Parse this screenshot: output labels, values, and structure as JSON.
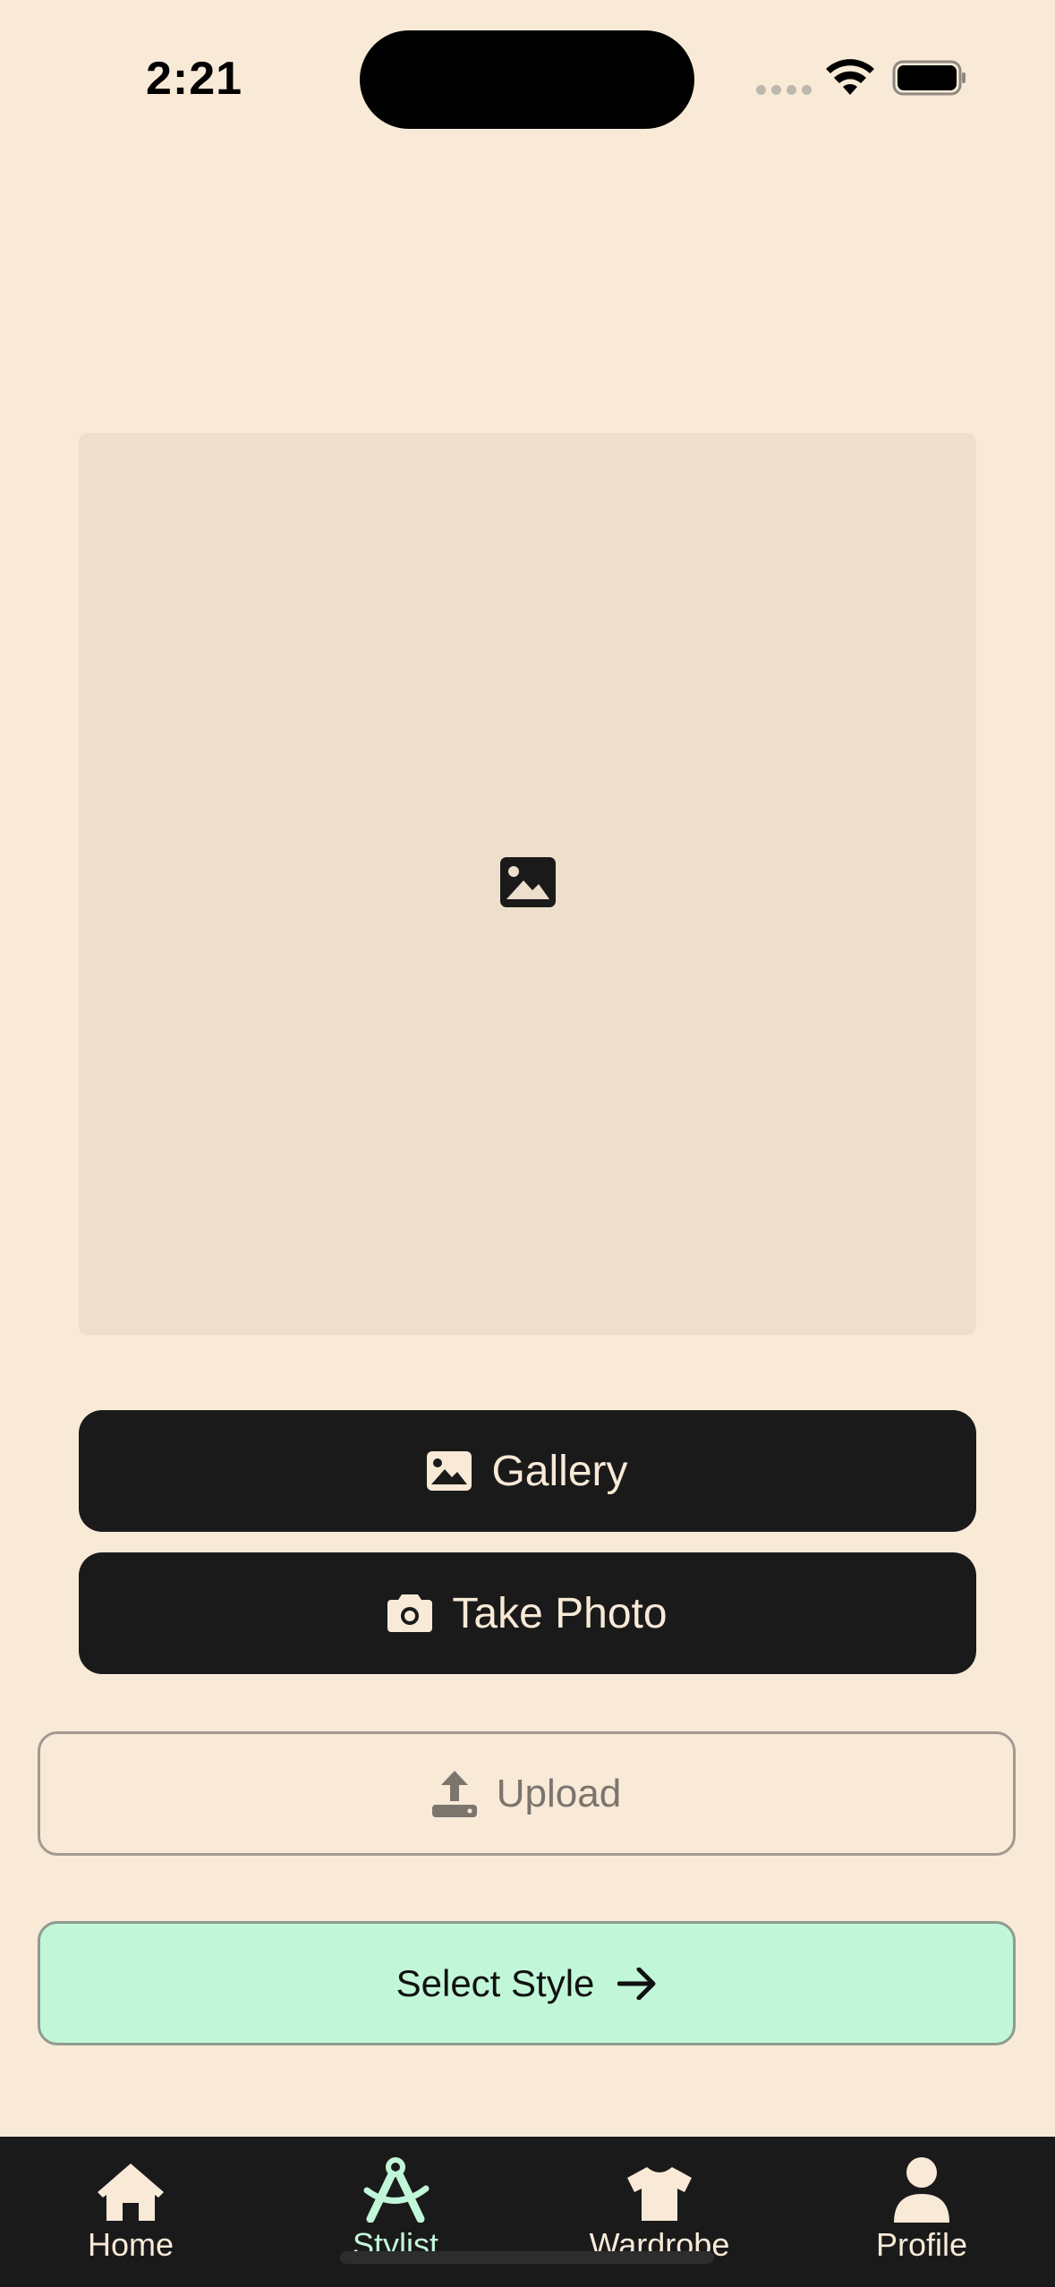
{
  "status_bar": {
    "time": "2:21"
  },
  "buttons": {
    "gallery_label": "Gallery",
    "take_photo_label": "Take Photo",
    "upload_label": "Upload",
    "select_style_label": "Select Style"
  },
  "tab_bar": {
    "items": [
      {
        "label": "Home",
        "icon": "home-icon",
        "active": false
      },
      {
        "label": "Stylist",
        "icon": "stylist-icon",
        "active": true
      },
      {
        "label": "Wardrobe",
        "icon": "shirt-icon",
        "active": false
      },
      {
        "label": "Profile",
        "icon": "person-icon",
        "active": false
      }
    ]
  },
  "colors": {
    "background": "#F8EAD7",
    "placeholder": "#EDDFCB",
    "dark": "#1B1A1B",
    "accent": "#C1F7D8"
  }
}
